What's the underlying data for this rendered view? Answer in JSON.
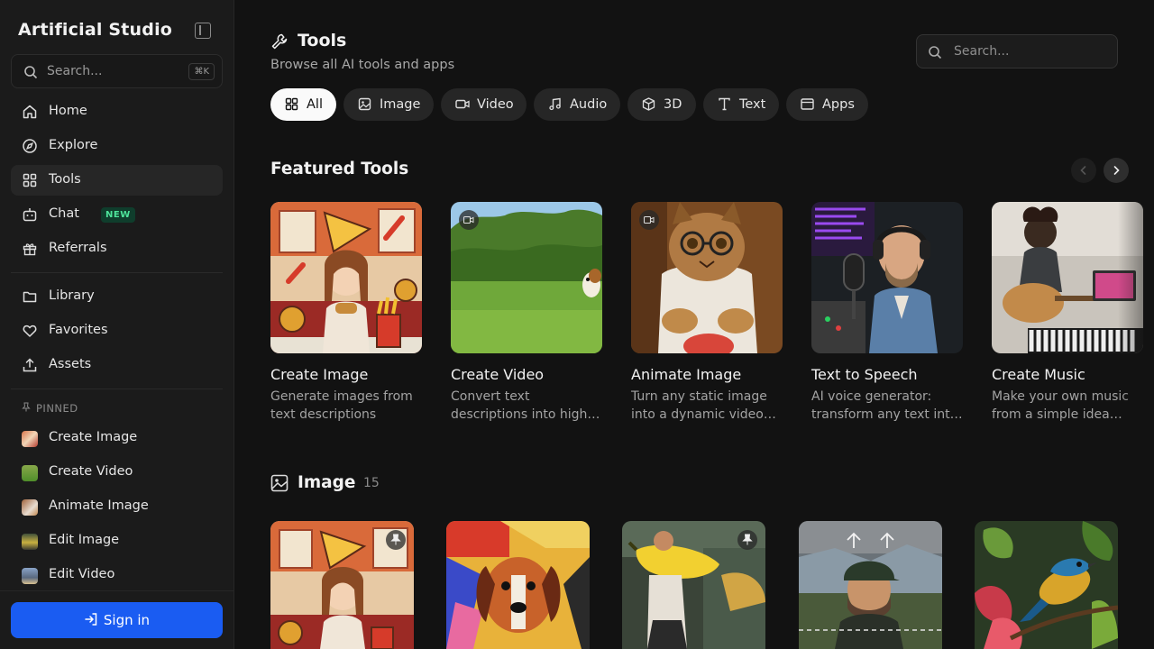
{
  "app": {
    "title": "Artificial Studio"
  },
  "sidebar": {
    "search": {
      "placeholder": "Search...",
      "shortcut": "⌘K"
    },
    "nav": [
      {
        "label": "Home",
        "icon": "home-icon"
      },
      {
        "label": "Explore",
        "icon": "compass-icon"
      },
      {
        "label": "Tools",
        "icon": "grid-icon",
        "active": true
      },
      {
        "label": "Chat",
        "icon": "bot-icon",
        "badge": "NEW"
      },
      {
        "label": "Referrals",
        "icon": "gift-icon"
      }
    ],
    "library": [
      {
        "label": "Library",
        "icon": "folder-icon"
      },
      {
        "label": "Favorites",
        "icon": "heart-icon"
      },
      {
        "label": "Assets",
        "icon": "upload-icon"
      }
    ],
    "pinned_heading": "PINNED",
    "pinned": [
      {
        "label": "Create Image"
      },
      {
        "label": "Create Video"
      },
      {
        "label": "Animate Image"
      },
      {
        "label": "Edit Image"
      },
      {
        "label": "Edit Video"
      }
    ],
    "signin_label": "Sign in"
  },
  "header": {
    "title": "Tools",
    "subtitle": "Browse all AI tools and apps",
    "search_placeholder": "Search..."
  },
  "filters": [
    {
      "label": "All",
      "icon": "grid-icon",
      "active": true
    },
    {
      "label": "Image",
      "icon": "image-icon"
    },
    {
      "label": "Video",
      "icon": "video-icon"
    },
    {
      "label": "Audio",
      "icon": "music-icon"
    },
    {
      "label": "3D",
      "icon": "cube-icon"
    },
    {
      "label": "Text",
      "icon": "type-icon"
    },
    {
      "label": "Apps",
      "icon": "window-icon"
    }
  ],
  "featured": {
    "title": "Featured Tools",
    "cards": [
      {
        "name": "Create Image",
        "desc": "Generate images from text descriptions"
      },
      {
        "name": "Create Video",
        "desc": "Convert text descriptions into high…"
      },
      {
        "name": "Animate Image",
        "desc": "Turn any static image into a dynamic video…"
      },
      {
        "name": "Text to Speech",
        "desc": "AI voice generator: transform any text int…"
      },
      {
        "name": "Create Music",
        "desc": "Make your own music from a simple idea…"
      }
    ]
  },
  "image_section": {
    "title": "Image",
    "count": "15"
  },
  "colors": {
    "accent": "#1a5cf2",
    "new_badge": "#4ee39b"
  }
}
